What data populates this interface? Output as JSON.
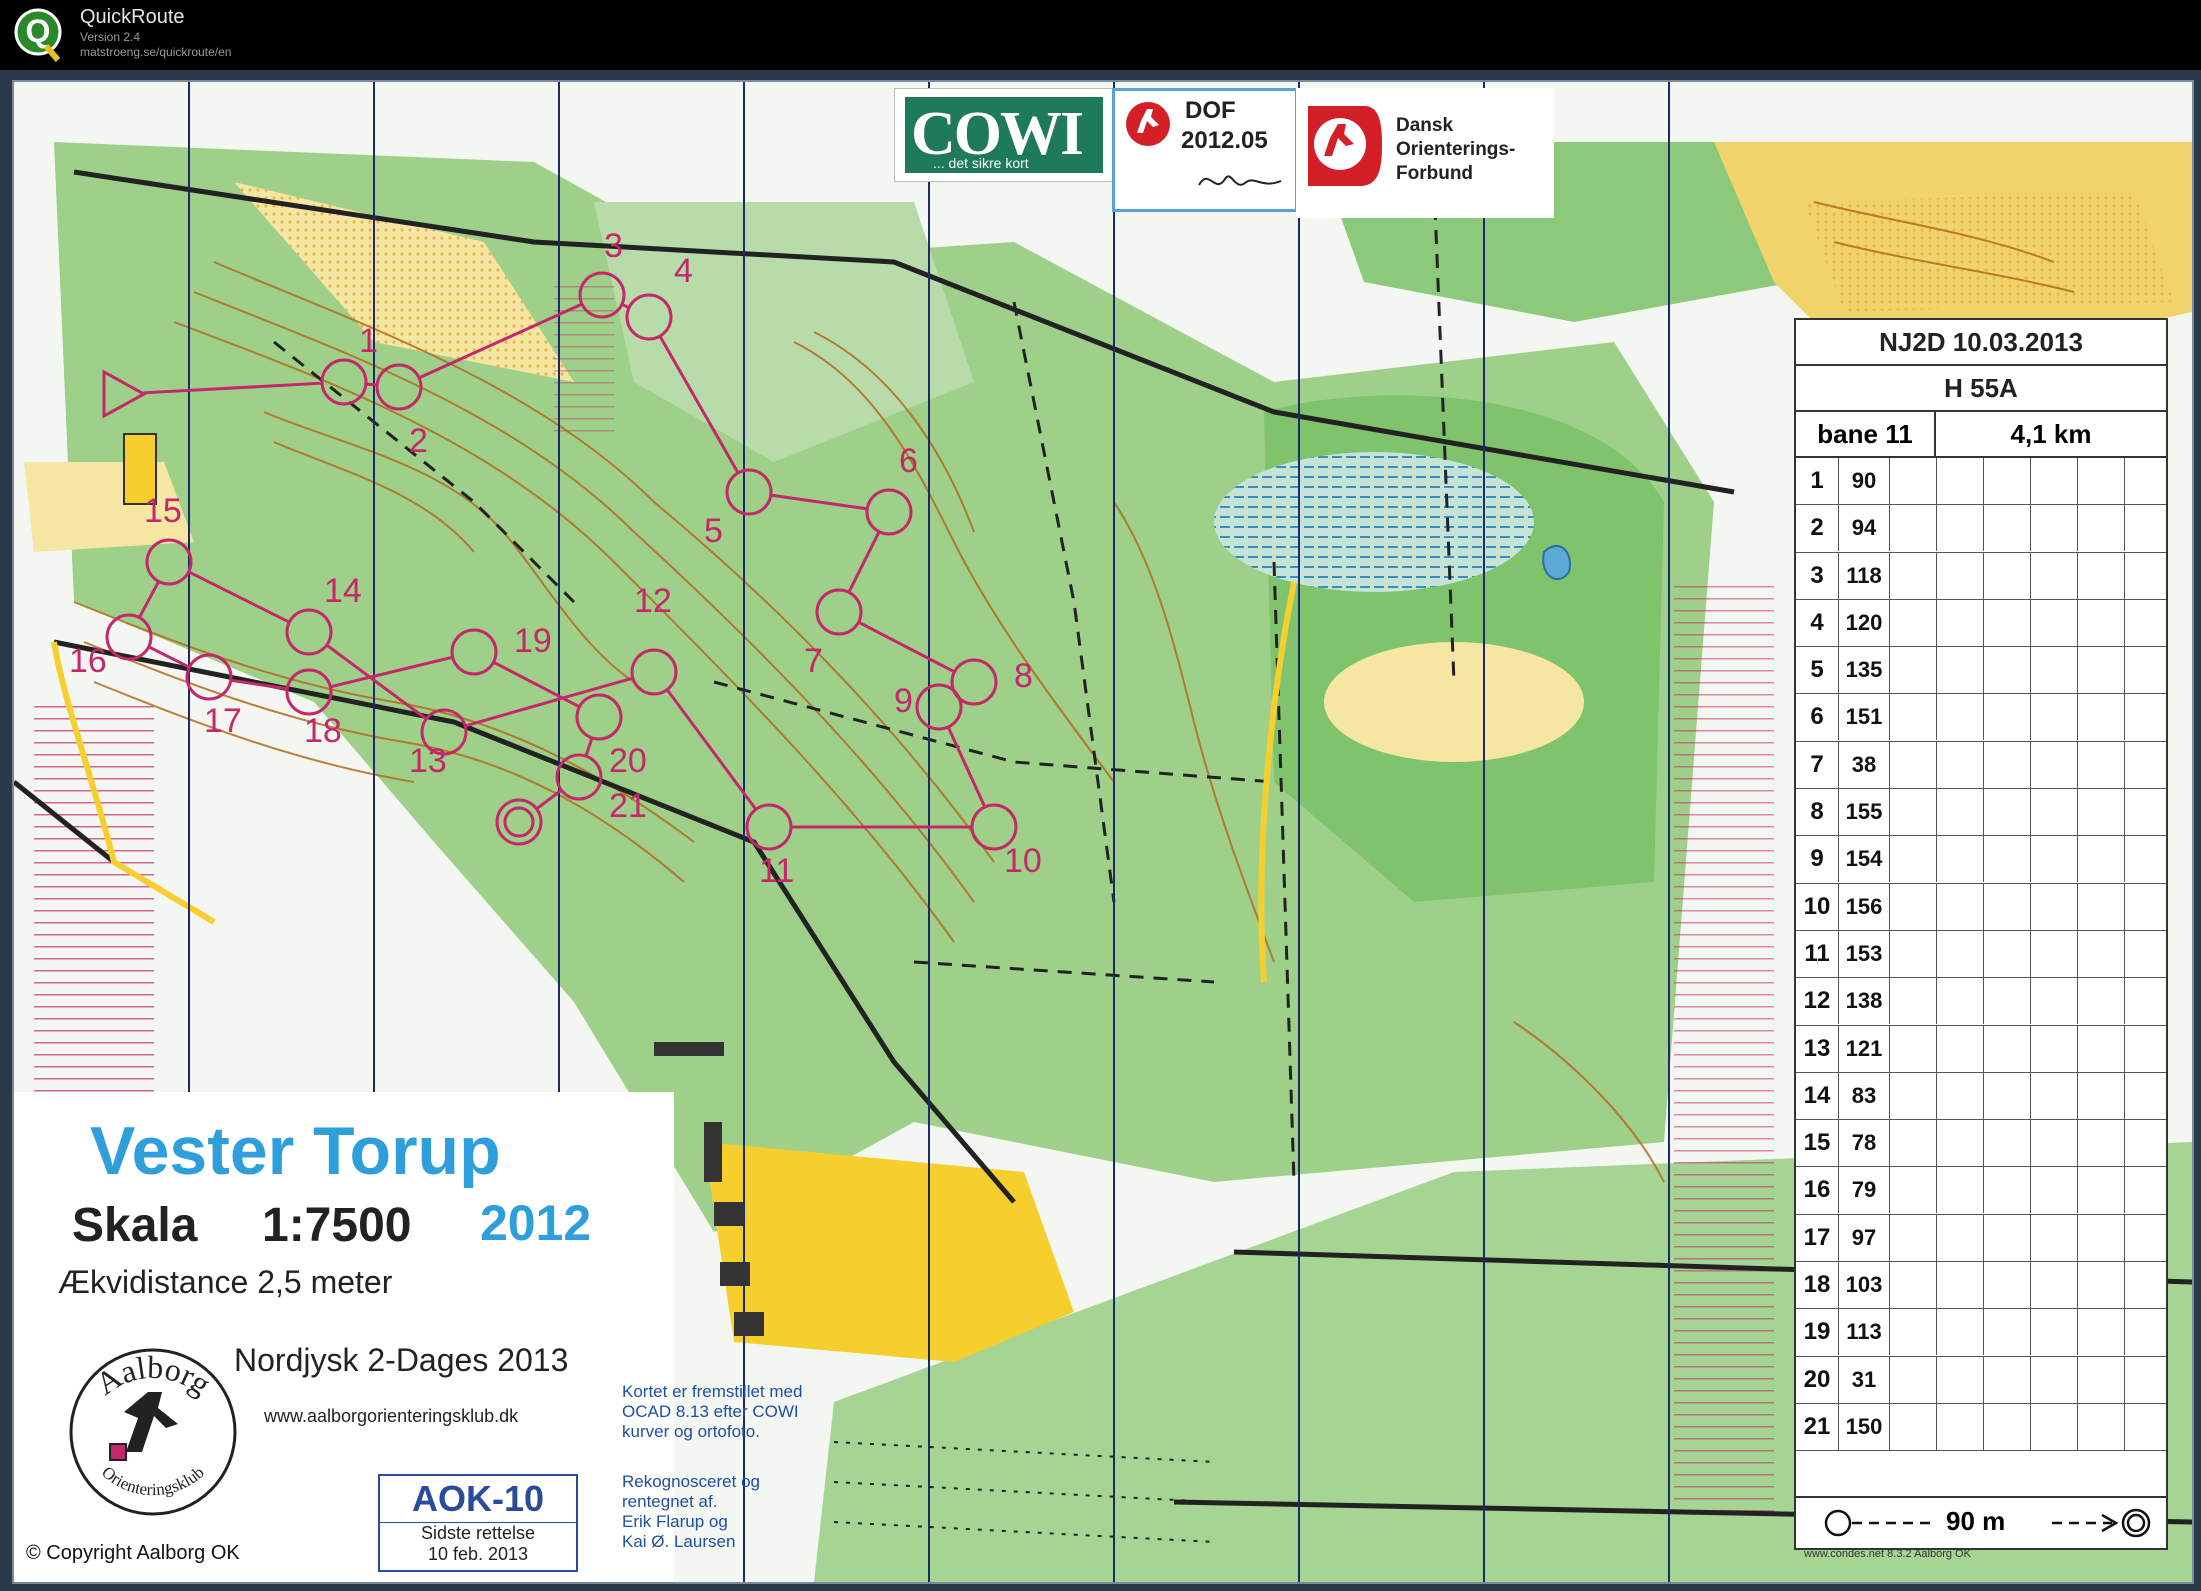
{
  "app": {
    "name": "QuickRoute",
    "version": "Version 2.4",
    "url": "matstroeng.se/quickroute/en"
  },
  "logos": {
    "cowi": "COWI",
    "cowi_tagline": "... det sikre kort",
    "dof_title": "DOF",
    "dof_number": "2012.05",
    "dansk_text": "Dansk\nOrienterings-\nForbund"
  },
  "map": {
    "title": "Vester Torup",
    "scale_label": "Skala",
    "scale_value": "1:7500",
    "year": "2012",
    "contour_interval": "Ækvidistance 2,5 meter",
    "event_name": "Nordjysk 2-Dages 2013",
    "club_url": "www.aalborgorienteringsklub.dk",
    "club_logo_top": "Aalborg",
    "club_logo_bottom": "Orienteringsklub",
    "map_id": "AOK-10",
    "revision_label": "Sidste rettelse",
    "revision_date": "10 feb. 2013",
    "copyright": "© Copyright  Aalborg OK",
    "credit_1": "Kortet er fremstillet med\nOCAD 8.13 efter COWI\nkurver og ortofoto.",
    "credit_2": "Rekognosceret og\nrentegnet af.\nErik Flarup og\nKai Ø. Laursen"
  },
  "colors": {
    "forest": "#8cc97a",
    "open": "#f0d36a",
    "rough_open": "#f5e6a4",
    "white_forest": "#f4f7f1",
    "contour": "#b36b1e",
    "course": "#c4276a",
    "water": "#5aa9d6"
  },
  "control_description": {
    "event": "NJ2D 10.03.2013",
    "class": "H 55A",
    "course": "bane 11",
    "length": "4,1 km",
    "finish_distance": "90 m",
    "footer": "www.condes.net 8.3.2 Aalborg OK",
    "controls": [
      {
        "n": "1",
        "code": "90"
      },
      {
        "n": "2",
        "code": "94"
      },
      {
        "n": "3",
        "code": "118"
      },
      {
        "n": "4",
        "code": "120"
      },
      {
        "n": "5",
        "code": "135"
      },
      {
        "n": "6",
        "code": "151"
      },
      {
        "n": "7",
        "code": "38"
      },
      {
        "n": "8",
        "code": "155"
      },
      {
        "n": "9",
        "code": "154"
      },
      {
        "n": "10",
        "code": "156"
      },
      {
        "n": "11",
        "code": "153"
      },
      {
        "n": "12",
        "code": "138"
      },
      {
        "n": "13",
        "code": "121"
      },
      {
        "n": "14",
        "code": "83"
      },
      {
        "n": "15",
        "code": "78"
      },
      {
        "n": "16",
        "code": "79"
      },
      {
        "n": "17",
        "code": "97"
      },
      {
        "n": "18",
        "code": "103"
      },
      {
        "n": "19",
        "code": "113"
      },
      {
        "n": "20",
        "code": "31"
      },
      {
        "n": "21",
        "code": "150"
      }
    ]
  },
  "course_controls": [
    {
      "label": "1"
    },
    {
      "label": "2"
    },
    {
      "label": "3"
    },
    {
      "label": "4"
    },
    {
      "label": "5"
    },
    {
      "label": "6"
    },
    {
      "label": "7"
    },
    {
      "label": "8"
    },
    {
      "label": "9"
    },
    {
      "label": "10"
    },
    {
      "label": "11"
    },
    {
      "label": "12"
    },
    {
      "label": "13"
    },
    {
      "label": "14"
    },
    {
      "label": "15"
    },
    {
      "label": "16"
    },
    {
      "label": "17"
    },
    {
      "label": "18"
    },
    {
      "label": "19"
    },
    {
      "label": "20"
    },
    {
      "label": "21"
    }
  ]
}
